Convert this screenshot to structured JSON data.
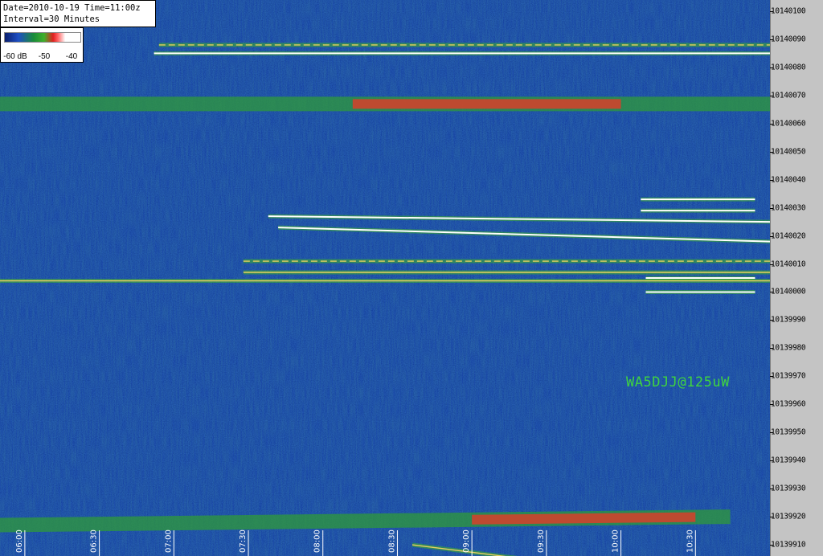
{
  "chart_data": {
    "type": "heatmap",
    "title": "",
    "info": {
      "date_line": "Date=2010-10-19 Time=11:00z",
      "interval_line": "Interval=30 Minutes"
    },
    "color_scale": {
      "labels": [
        "-60 dB",
        "-50",
        "-40"
      ],
      "unit": "dB",
      "range_db": [
        -60,
        -40
      ]
    },
    "x_axis": {
      "label": "",
      "ticks": [
        "06:00",
        "06:30",
        "07:00",
        "07:30",
        "08:00",
        "08:30",
        "09:00",
        "09:30",
        "10:00",
        "10:30"
      ],
      "range": [
        "05:50",
        "11:00"
      ]
    },
    "y_axis": {
      "label": "",
      "ticks": [
        "10140100",
        "10140090",
        "10140080",
        "10140070",
        "10140060",
        "10140050",
        "10140040",
        "10140030",
        "10140020",
        "10140010",
        "10140000",
        "10139990",
        "10139980",
        "10139970",
        "10139960",
        "10139950",
        "10139940",
        "10139930",
        "10139920",
        "10139910"
      ],
      "range": [
        10139906,
        10140104
      ]
    },
    "annotation": "WA5DJJ@125uW",
    "traces": [
      {
        "freq_start": 10140088,
        "freq_end": 10140088,
        "t_start": "06:54",
        "t_end": "11:00",
        "intensity": "medium",
        "style": "dashed"
      },
      {
        "freq_start": 10140085,
        "freq_end": 10140085,
        "t_start": "06:52",
        "t_end": "11:00",
        "intensity": "high",
        "style": "solid"
      },
      {
        "freq_start": 10140067,
        "freq_end": 10140067,
        "t_start": "05:50",
        "t_end": "11:00",
        "intensity": "band",
        "style": "band",
        "peak_start": "08:12",
        "peak_end": "10:00"
      },
      {
        "freq_start": 10140027,
        "freq_end": 10140025,
        "t_start": "07:38",
        "t_end": "11:00",
        "intensity": "high",
        "style": "solid"
      },
      {
        "freq_start": 10140023,
        "freq_end": 10140018,
        "t_start": "07:42",
        "t_end": "11:00",
        "intensity": "high",
        "style": "solid"
      },
      {
        "freq_start": 10140033,
        "freq_end": 10140033,
        "t_start": "10:08",
        "t_end": "10:54",
        "intensity": "high",
        "style": "solid"
      },
      {
        "freq_start": 10140029,
        "freq_end": 10140029,
        "t_start": "10:08",
        "t_end": "10:54",
        "intensity": "high",
        "style": "solid"
      },
      {
        "freq_start": 10140011,
        "freq_end": 10140011,
        "t_start": "07:28",
        "t_end": "11:00",
        "intensity": "medium",
        "style": "dashed"
      },
      {
        "freq_start": 10140007,
        "freq_end": 10140007,
        "t_start": "07:28",
        "t_end": "11:00",
        "intensity": "medium",
        "style": "solid"
      },
      {
        "freq_start": 10140004,
        "freq_end": 10140004,
        "t_start": "05:50",
        "t_end": "11:00",
        "intensity": "medium",
        "style": "solid"
      },
      {
        "freq_start": 10140005,
        "freq_end": 10140005,
        "t_start": "10:10",
        "t_end": "10:54",
        "intensity": "high",
        "style": "solid"
      },
      {
        "freq_start": 10140000,
        "freq_end": 10140000,
        "t_start": "10:10",
        "t_end": "10:54",
        "intensity": "high",
        "style": "solid"
      },
      {
        "freq_start": 10139917,
        "freq_end": 10139920,
        "t_start": "05:50",
        "t_end": "10:44",
        "intensity": "band",
        "style": "band",
        "peak_start": "09:00",
        "peak_end": "10:30"
      },
      {
        "freq_start": 10139910,
        "freq_end": 10139904,
        "t_start": "08:36",
        "t_end": "09:30",
        "intensity": "medium",
        "style": "solid"
      }
    ]
  }
}
